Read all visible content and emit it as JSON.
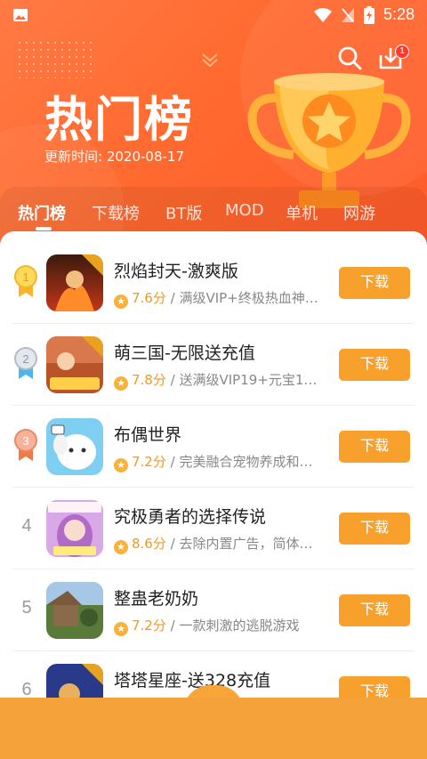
{
  "status_bar": {
    "time": "5:28"
  },
  "header": {
    "title": "热门榜",
    "update_label": "更新时间:",
    "update_date": "2020-08-17",
    "download_badge": "1"
  },
  "tabs": [
    {
      "label": "热门榜",
      "active": true
    },
    {
      "label": "下载榜",
      "active": false
    },
    {
      "label": "BT版",
      "active": false
    },
    {
      "label": "MOD",
      "active": false
    },
    {
      "label": "单机",
      "active": false
    },
    {
      "label": "网游",
      "active": false
    }
  ],
  "games": [
    {
      "rank": "1",
      "name": "烈焰封天-激爽版",
      "score": "7.6分",
      "desc": "满级VIP+终极热血神…",
      "button": "下载",
      "icon": "fire-warrior-icon"
    },
    {
      "rank": "2",
      "name": "萌三国-无限送充值",
      "score": "7.8分",
      "desc": "送满级VIP19+元宝1…",
      "button": "下载",
      "icon": "three-kingdoms-icon"
    },
    {
      "rank": "3",
      "name": "布偶世界",
      "score": "7.2分",
      "desc": "完美融合宠物养成和…",
      "button": "下载",
      "icon": "puppet-dog-icon"
    },
    {
      "rank": "4",
      "name": "究极勇者的选择传说",
      "score": "8.6分",
      "desc": "去除内置广告，简体…",
      "button": "下载",
      "icon": "anime-girl-icon"
    },
    {
      "rank": "5",
      "name": "整蛊老奶奶",
      "score": "7.2分",
      "desc": "一款刺激的逃脱游戏",
      "button": "下载",
      "icon": "granny-prank-icon"
    },
    {
      "rank": "6",
      "name": "塔塔星座-送328充值",
      "score": "",
      "desc": "",
      "button": "下载",
      "icon": "constellation-icon"
    }
  ],
  "colors": {
    "header_orange": "#ff6a2f",
    "button_orange": "#f7a02c",
    "score_orange": "#f39a1c"
  }
}
